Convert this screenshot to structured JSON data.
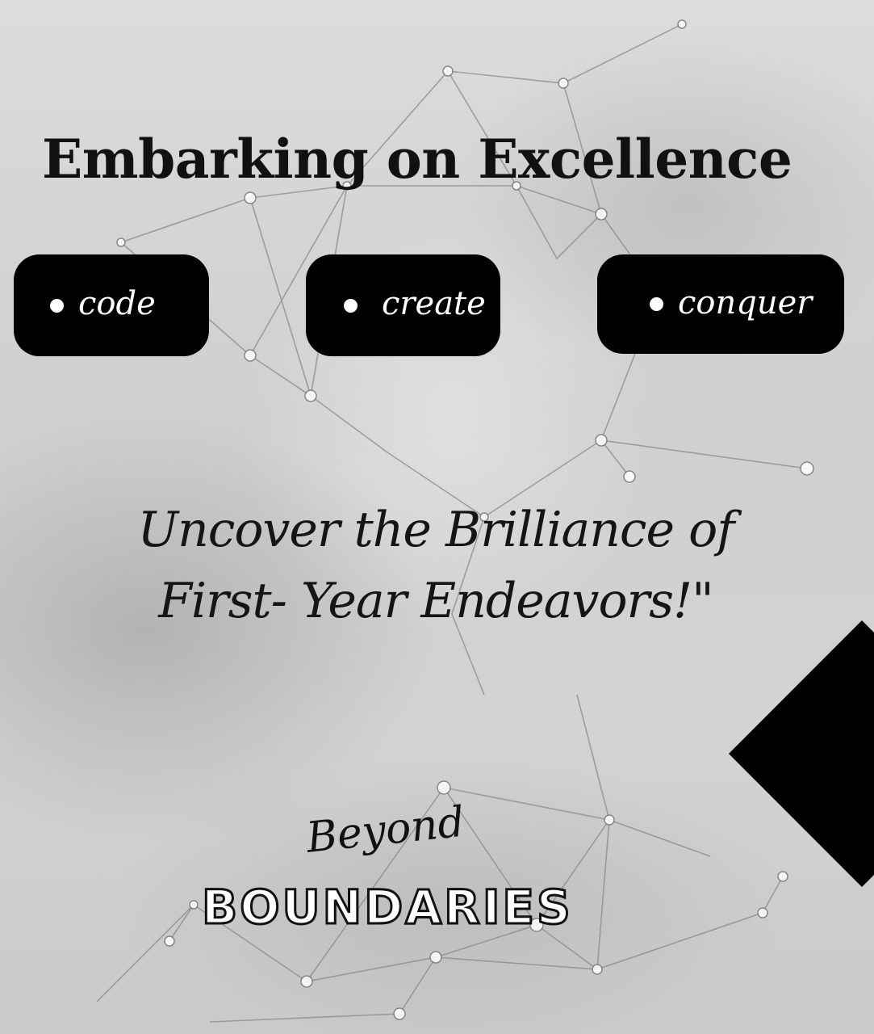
{
  "poster": {
    "headline": "Embarking on Excellence",
    "pills": [
      {
        "label": "code"
      },
      {
        "label": "create"
      },
      {
        "label": "conquer"
      }
    ],
    "tagline": {
      "line1": "Uncover the Brilliance of",
      "line2": "First- Year Endeavors!\""
    },
    "logo": {
      "script": "Beyond",
      "block": "BOUNDARIES"
    }
  },
  "colors": {
    "pill_background": "#000000",
    "pill_text": "#ffffff",
    "headline_text": "#111111",
    "background": "#d3d3d3"
  }
}
